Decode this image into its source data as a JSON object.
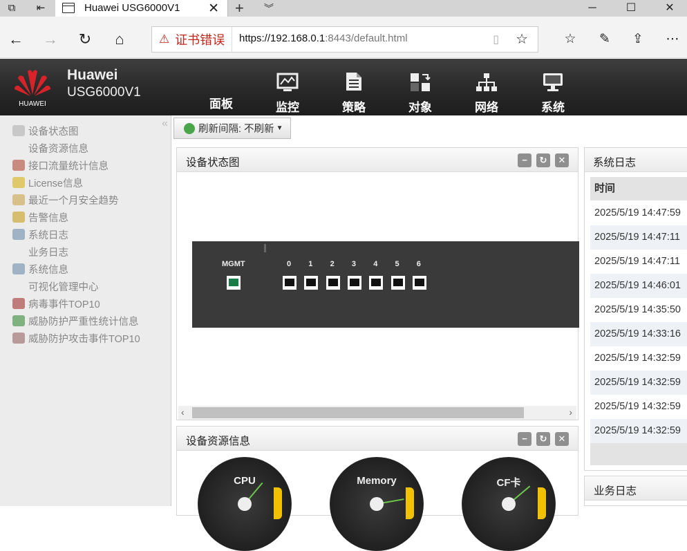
{
  "browser": {
    "tab_title": "Huawei USG6000V1",
    "cert_error": "证书错误",
    "url_prefix": "https://192.168.0.1",
    "url_port": ":8443",
    "url_path": "/default.html"
  },
  "header": {
    "logo_text": "HUAWEI",
    "brand_name": "Huawei",
    "product": "USG6000V1",
    "nav": [
      "面板",
      "监控",
      "策略",
      "对象",
      "网络",
      "系统"
    ]
  },
  "sidebar": {
    "items": [
      {
        "label": "设备状态图",
        "icon": "status-graph-icon",
        "color": "#c8c8c8"
      },
      {
        "label": "设备资源信息",
        "icon": "",
        "color": ""
      },
      {
        "label": "接口流量统计信息",
        "icon": "interface-traffic-icon",
        "color": "#c98b7d"
      },
      {
        "label": "License信息",
        "icon": "license-icon",
        "color": "#e0c96b"
      },
      {
        "label": "最近一个月安全趋势",
        "icon": "security-trend-icon",
        "color": "#d8c08a"
      },
      {
        "label": "告警信息",
        "icon": "alarm-icon",
        "color": "#d6bd70"
      },
      {
        "label": "系统日志",
        "icon": "system-log-icon",
        "color": "#9fb3c4"
      },
      {
        "label": "业务日志",
        "icon": "",
        "color": ""
      },
      {
        "label": "系统信息",
        "icon": "system-info-icon",
        "color": "#9fb3c4"
      },
      {
        "label": "可视化管理中心",
        "icon": "",
        "color": ""
      },
      {
        "label": "病毒事件TOP10",
        "icon": "virus-icon",
        "color": "#c07b7b"
      },
      {
        "label": "威胁防护严重性统计信息",
        "icon": "threat-severity-icon",
        "color": "#7fb27f"
      },
      {
        "label": "威胁防护攻击事件TOP10",
        "icon": "threat-attack-icon",
        "color": "#b89a9a"
      }
    ]
  },
  "toolbar": {
    "refresh_label": "刷新间隔: 不刷新"
  },
  "device_panel": {
    "title": "设备状态图",
    "mgmt_label": "MGMT",
    "ports": [
      "0",
      "1",
      "2",
      "3",
      "4",
      "5",
      "6"
    ]
  },
  "resource_panel": {
    "title": "设备资源信息",
    "gauges": [
      "CPU",
      "Memory",
      "CF卡"
    ]
  },
  "syslog_panel": {
    "title": "系统日志",
    "col_time": "时间",
    "rows": [
      "2025/5/19 14:47:59",
      "2025/5/19 14:47:11",
      "2025/5/19 14:47:11",
      "2025/5/19 14:46:01",
      "2025/5/19 14:35:50",
      "2025/5/19 14:33:16",
      "2025/5/19 14:32:59",
      "2025/5/19 14:32:59",
      "2025/5/19 14:32:59",
      "2025/5/19 14:32:59"
    ]
  },
  "bizlog_panel": {
    "title": "业务日志"
  }
}
